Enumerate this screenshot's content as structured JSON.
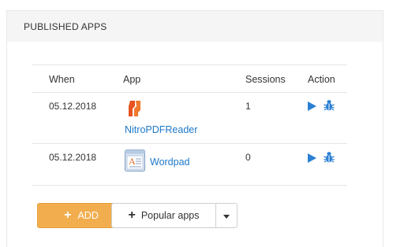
{
  "panel": {
    "title": "PUBLISHED APPS"
  },
  "table": {
    "headers": {
      "when": "When",
      "app": "App",
      "sessions": "Sessions",
      "action": "Action"
    },
    "rows": [
      {
        "when": "05.12.2018",
        "app": "NitroPDFReader",
        "app_icon": "nitro-pdf-icon",
        "sessions": "1"
      },
      {
        "when": "05.12.2018",
        "app": "Wordpad",
        "app_icon": "wordpad-icon",
        "sessions": "0"
      }
    ]
  },
  "buttons": {
    "add_label": "ADD",
    "popular_label": "Popular apps"
  },
  "colors": {
    "accent_orange": "#f2ad4e",
    "link_blue": "#1e78c8",
    "action_blue": "#2a7fd4"
  }
}
